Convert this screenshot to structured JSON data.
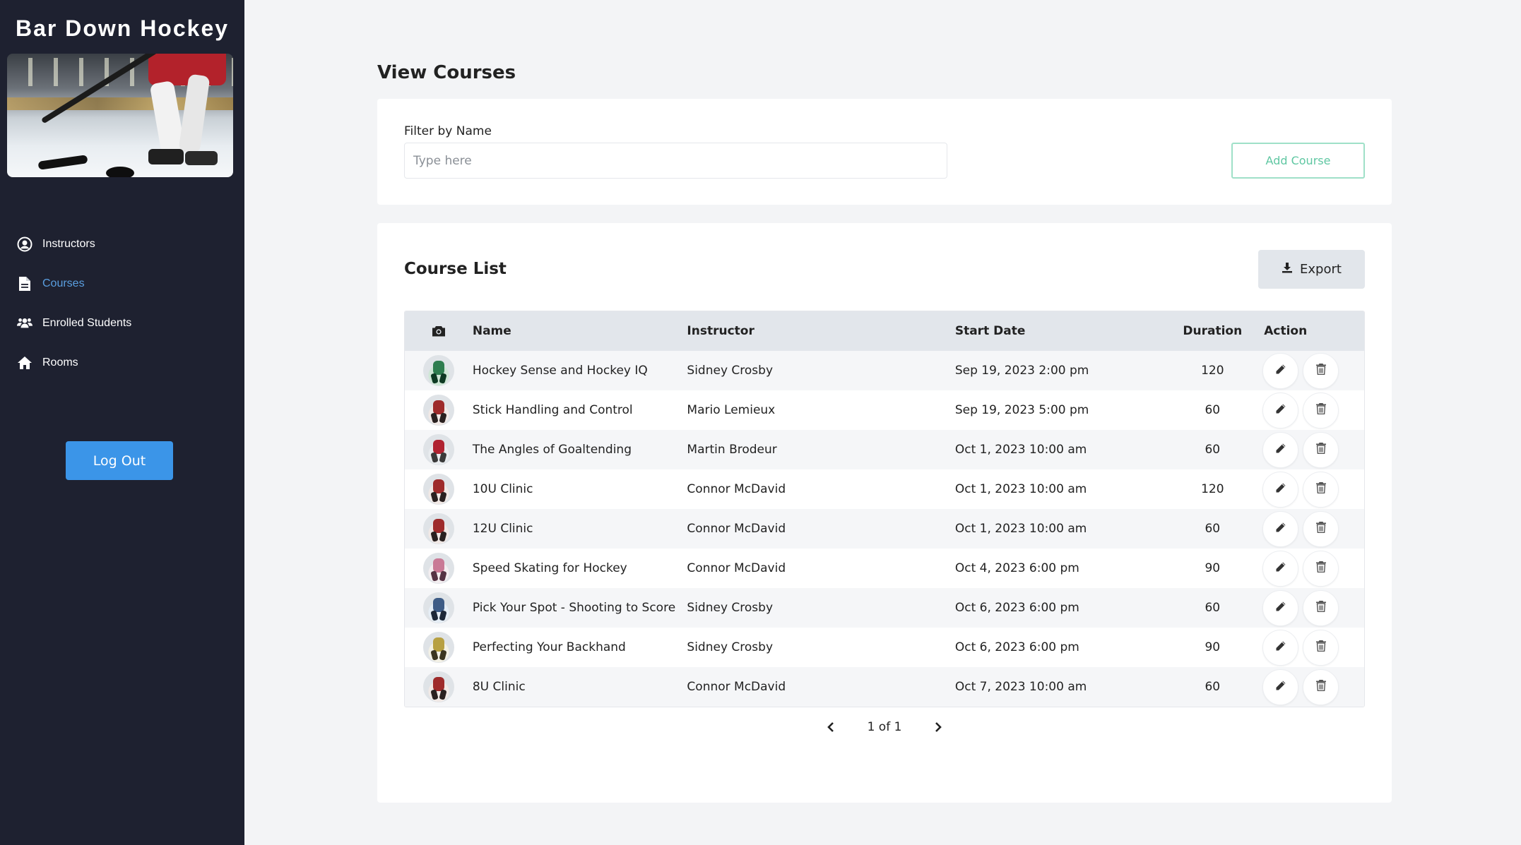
{
  "sidebar": {
    "brand": "Bar Down Hockey",
    "nav": [
      {
        "label": "Instructors",
        "icon": "user-circle-icon"
      },
      {
        "label": "Courses",
        "icon": "document-icon",
        "active": true
      },
      {
        "label": "Enrolled Students",
        "icon": "users-icon"
      },
      {
        "label": "Rooms",
        "icon": "home-icon"
      }
    ],
    "logout_label": "Log Out"
  },
  "main": {
    "page_title": "View Courses",
    "filter": {
      "label": "Filter by Name",
      "placeholder": "Type here",
      "value": "",
      "add_label": "Add Course"
    },
    "list": {
      "title": "Course List",
      "export_label": "Export",
      "columns": [
        "Name",
        "Instructor",
        "Start Date",
        "Duration",
        "Action"
      ],
      "rows": [
        {
          "name": "Hockey Sense and Hockey IQ",
          "instructor": "Sidney Crosby",
          "start": "Sep 19, 2023 2:00 pm",
          "duration": "120",
          "thumb": "green"
        },
        {
          "name": "Stick Handling and Control",
          "instructor": "Mario Lemieux",
          "start": "Sep 19, 2023 5:00 pm",
          "duration": "60",
          "thumb": "red"
        },
        {
          "name": "The Angles of Goaltending",
          "instructor": "Martin Brodeur",
          "start": "Oct 1, 2023 10:00 am",
          "duration": "60",
          "thumb": "goalie"
        },
        {
          "name": "10U Clinic",
          "instructor": "Connor McDavid",
          "start": "Oct 1, 2023 10:00 am",
          "duration": "120",
          "thumb": "red"
        },
        {
          "name": "12U Clinic",
          "instructor": "Connor McDavid",
          "start": "Oct 1, 2023 10:00 am",
          "duration": "60",
          "thumb": "red"
        },
        {
          "name": "Speed Skating for Hockey",
          "instructor": "Connor McDavid",
          "start": "Oct 4, 2023 6:00 pm",
          "duration": "90",
          "thumb": "pink"
        },
        {
          "name": "Pick Your Spot - Shooting to Score",
          "instructor": "Sidney Crosby",
          "start": "Oct 6, 2023 6:00 pm",
          "duration": "60",
          "thumb": "blue"
        },
        {
          "name": "Perfecting Your Backhand",
          "instructor": "Sidney Crosby",
          "start": "Oct 6, 2023 6:00 pm",
          "duration": "90",
          "thumb": "yellow"
        },
        {
          "name": "8U Clinic",
          "instructor": "Connor McDavid",
          "start": "Oct 7, 2023 10:00 am",
          "duration": "60",
          "thumb": "red"
        }
      ]
    },
    "pager": {
      "text": "1 of 1"
    }
  },
  "colors": {
    "sidebar_bg": "#1e2130",
    "active_nav": "#5a9fe0",
    "logout_bg": "#3b95e8",
    "add_course_border": "#9fe0c8",
    "add_course_text": "#5fc7a2",
    "header_bg": "#e2e6eb"
  }
}
